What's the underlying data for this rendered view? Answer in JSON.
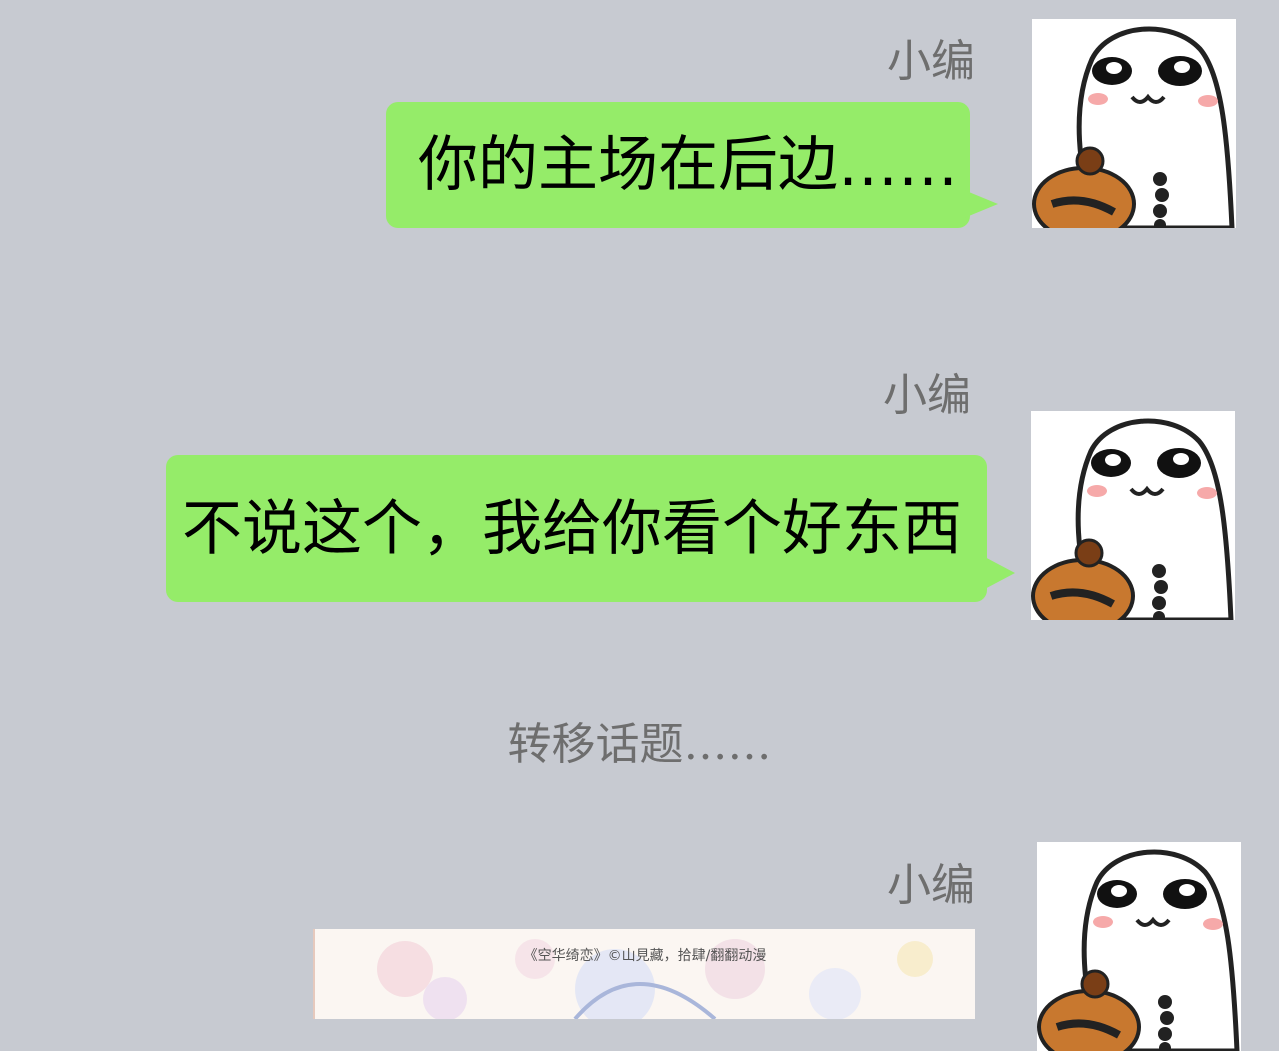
{
  "colors": {
    "background": "#c7cad1",
    "bubble": "#95ec69",
    "sender_text": "#6e6e6e"
  },
  "messages": [
    {
      "sender": "小编",
      "text": "你的主场在后边……",
      "avatar_icon": "cute-blob-avatar-icon"
    },
    {
      "sender": "小编",
      "text": "不说这个，我给你看个好东西",
      "avatar_icon": "cute-blob-avatar-icon"
    },
    {
      "sender": "小编",
      "avatar_icon": "cute-blob-avatar-icon",
      "image_credit": "《空华绮恋》©山見藏，拾肆/翻翻动漫"
    }
  ],
  "divider": {
    "text": "转移话题……"
  }
}
